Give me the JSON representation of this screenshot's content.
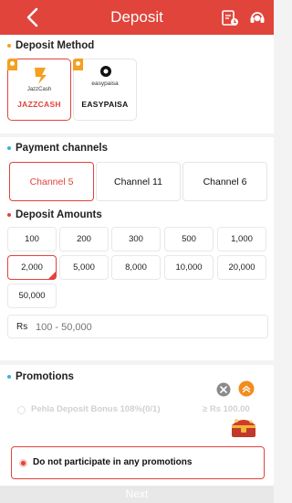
{
  "header": {
    "title": "Deposit",
    "back_icon": "back-arrow-icon",
    "icons": [
      "deposit-history-icon",
      "customer-service-icon"
    ]
  },
  "deposit_method": {
    "title": "Deposit Method",
    "items": [
      {
        "label": "JAZZCASH",
        "logo_text": "JazzCash",
        "selected": true,
        "color": "#e0443b"
      },
      {
        "label": "EASYPAISA",
        "logo_text": "easypaisa",
        "selected": false,
        "color": "#111111"
      }
    ]
  },
  "payment_channels": {
    "title": "Payment channels",
    "items": [
      {
        "label": "Channel 5",
        "selected": true
      },
      {
        "label": "Channel 11",
        "selected": false
      },
      {
        "label": "Channel 6",
        "selected": false
      }
    ]
  },
  "deposit_amounts": {
    "title": "Deposit Amounts",
    "items": [
      "100",
      "200",
      "300",
      "500",
      "1,000",
      "2,000",
      "5,000",
      "8,000",
      "10,000",
      "20,000",
      "50,000"
    ],
    "selected": "2,000"
  },
  "amount_input": {
    "currency": "Rs",
    "placeholder": "100 - 50,000"
  },
  "promotions": {
    "title": "Promotions",
    "item": {
      "label": "Pehla Deposit Bonus 108%(0/1)",
      "amount": "≥ Rs 100.00"
    },
    "none_label": "Do not participate in any promotions"
  },
  "next_button": {
    "label": "Next"
  },
  "colors": {
    "accent": "#e0443b",
    "ribbon": "#f4a020"
  }
}
